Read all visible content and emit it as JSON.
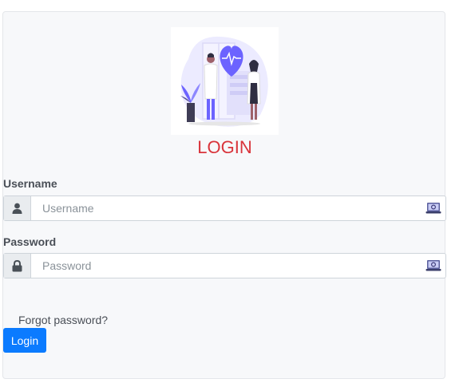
{
  "form": {
    "title": "LOGIN",
    "username_label": "Username",
    "username_placeholder": "Username",
    "password_label": "Password",
    "password_placeholder": "Password",
    "forgot_password": "Forgot password?",
    "login_button": "Login"
  },
  "colors": {
    "title": "#d9343b",
    "button": "#0b7bff",
    "card_bg": "#f7f8fa",
    "illustration_accent": "#6c63ff"
  },
  "icons": {
    "username_addon": "user-icon",
    "password_addon": "lock-icon",
    "field_trailing": "password-manager-icon",
    "hero": "doctors-illustration"
  }
}
